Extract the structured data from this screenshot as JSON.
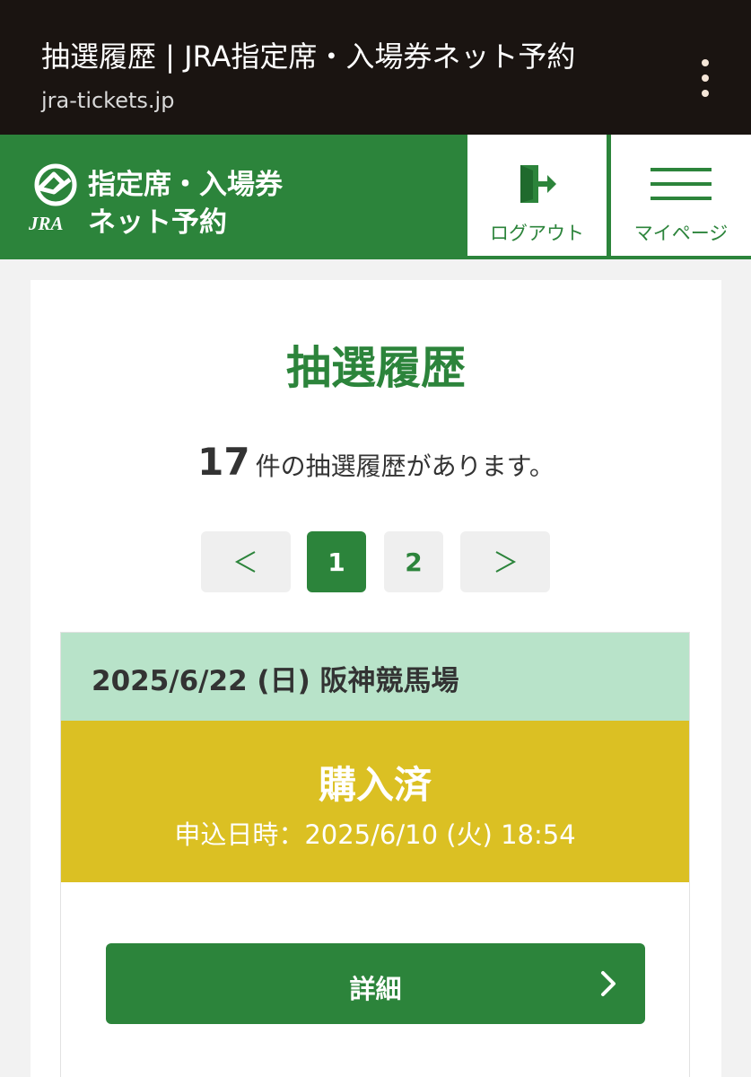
{
  "browser": {
    "page_title": "抽選履歴 | JRA指定席・入場券ネット予約",
    "url": "jra-tickets.jp"
  },
  "header": {
    "logo_text": "JRA",
    "site_name_line1": "指定席・入場券",
    "site_name_line2": "ネット予約",
    "logout_label": "ログアウト",
    "mypage_label": "マイページ"
  },
  "main": {
    "page_title": "抽選履歴",
    "count": "17",
    "count_suffix": "件の抽選履歴があります。"
  },
  "pagination": {
    "prev": "<",
    "pages": [
      "1",
      "2"
    ],
    "current_page": "1",
    "next": ">"
  },
  "entries": [
    {
      "date_venue": "2025/6/22 (日) 阪神競馬場",
      "status": "購入済",
      "applied_at": "申込日時：2025/6/10 (火) 18:54",
      "detail_label": "詳細"
    }
  ],
  "colors": {
    "brand_green": "#2c843b",
    "entry_header_bg": "#b8e3c9",
    "status_bg": "#dbc023",
    "chrome_bg": "#1a1411"
  }
}
